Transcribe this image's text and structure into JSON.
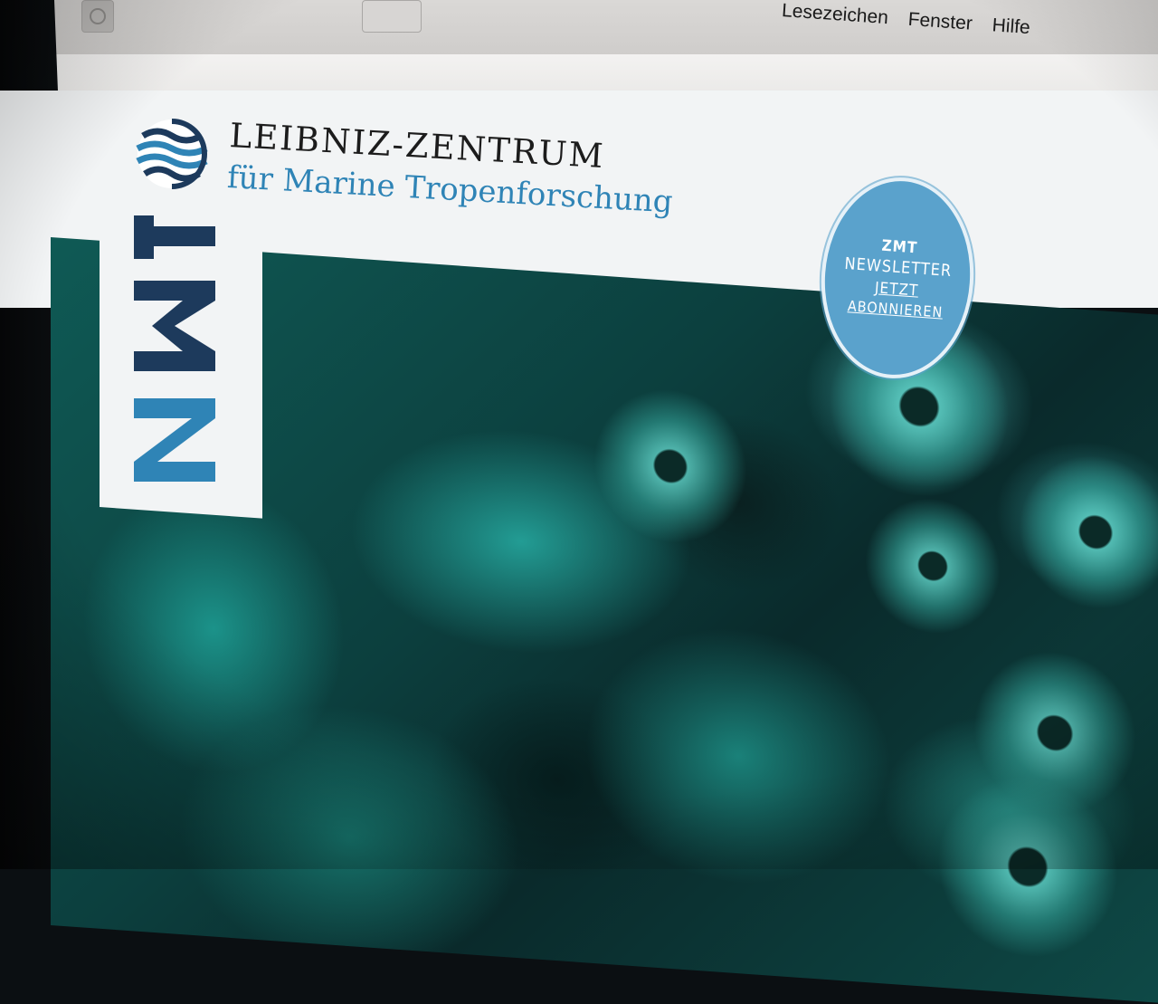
{
  "menubar": {
    "items": [
      "Lesezeichen",
      "Fenster",
      "Hilfe"
    ]
  },
  "header": {
    "logo_text": "ZMT",
    "title_line1": "LEIBNIZ-ZENTRUM",
    "title_line2": "für Marine Tropenforschung"
  },
  "newsletter_badge": {
    "line1": "ZMT",
    "line2": "NEWSLETTER",
    "line3": "JETZT",
    "line4": "ABONNIEREN"
  },
  "colors": {
    "brand_blue": "#2f84b6",
    "brand_navy": "#1d3a5c",
    "badge_blue": "#5aa2cc"
  }
}
